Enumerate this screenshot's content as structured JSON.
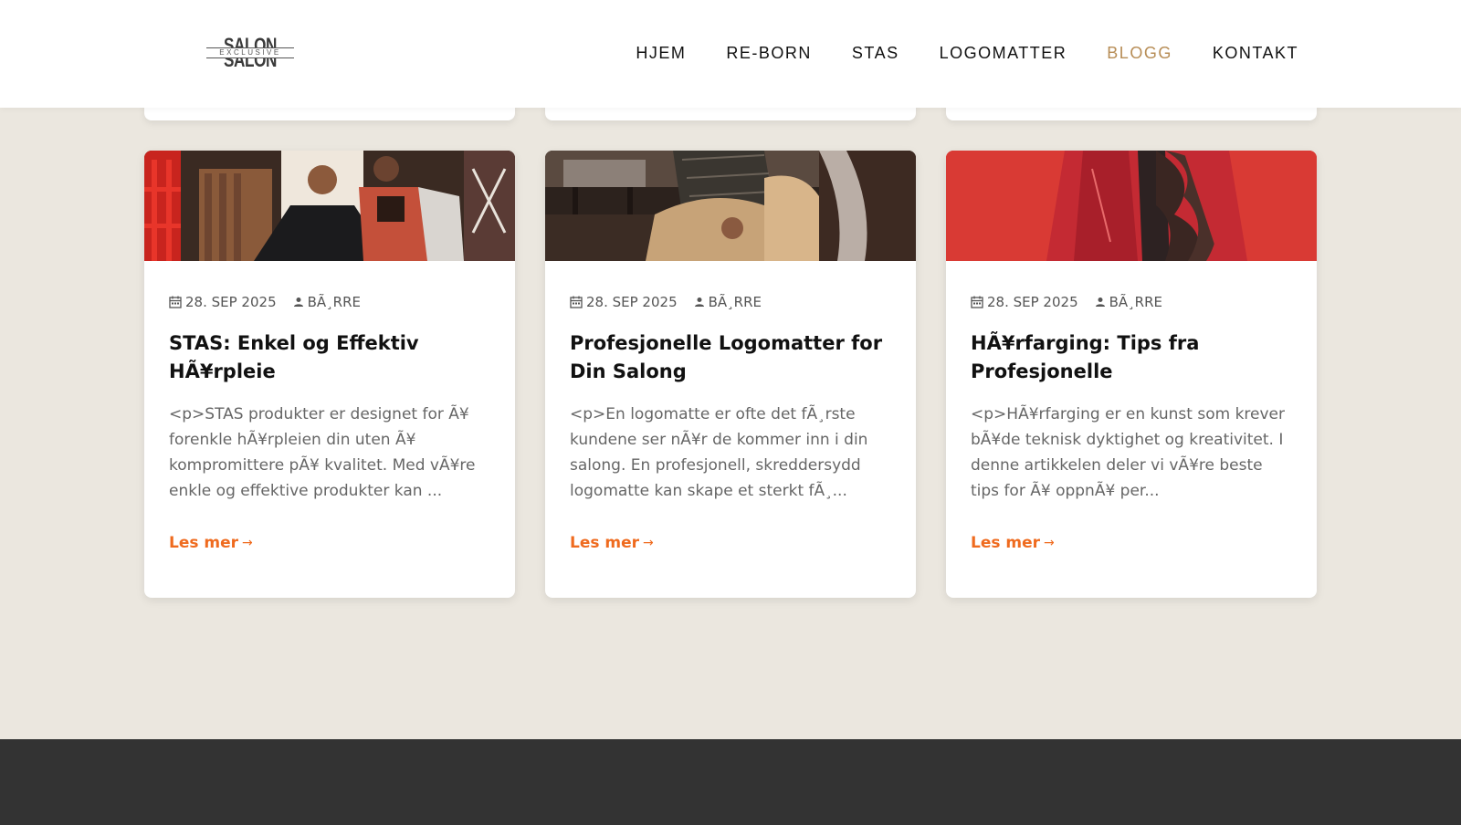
{
  "brand": {
    "logo_top": "SALON",
    "logo_band": "EXCLUSIVE",
    "logo_bottom": "SALON"
  },
  "nav": {
    "items": [
      {
        "label": "HJEM"
      },
      {
        "label": "RE-BORN"
      },
      {
        "label": "STAS"
      },
      {
        "label": "LOGOMATTER"
      },
      {
        "label": "BLOGG"
      },
      {
        "label": "KONTAKT"
      }
    ],
    "active_index": 4
  },
  "colors": {
    "accent_nav": "#b78d56",
    "read_more": "#ef6b1f",
    "page_bg": "#ebe7df",
    "footer_bg": "#333333"
  },
  "posts": [
    {
      "date": "28. SEP 2025",
      "author": "BÃ¸RRE",
      "title": "STAS: Enkel og Effektiv HÃ¥rpleie",
      "excerpt": "<p>STAS produkter er designet for Ã¥ forenkle hÃ¥rpleien din uten Ã¥ kompromittere pÃ¥ kvalitet. Med vÃ¥re enkle og effektive produkter kan ...",
      "read_more": "Les mer"
    },
    {
      "date": "28. SEP 2025",
      "author": "BÃ¸RRE",
      "title": "Profesjonelle Logomatter for Din Salong",
      "excerpt": "<p>En logomatte er ofte det fÃ¸rste kundene ser nÃ¥r de kommer inn i din salong. En profesjonell, skreddersydd logomatte kan skape et sterkt fÃ¸...",
      "read_more": "Les mer"
    },
    {
      "date": "28. SEP 2025",
      "author": "BÃ¸RRE",
      "title": "HÃ¥rfarging: Tips fra Profesjonelle",
      "excerpt": "<p>HÃ¥rfarging er en kunst som krever bÃ¥de teknisk dyktighet og kreativitet. I denne artikkelen deler vi vÃ¥re beste tips for Ã¥ oppnÃ¥ per...",
      "read_more": "Les mer"
    }
  ],
  "icons": {
    "date": "calendar-icon",
    "author": "user-icon",
    "read_more": "arrow-right-icon"
  }
}
